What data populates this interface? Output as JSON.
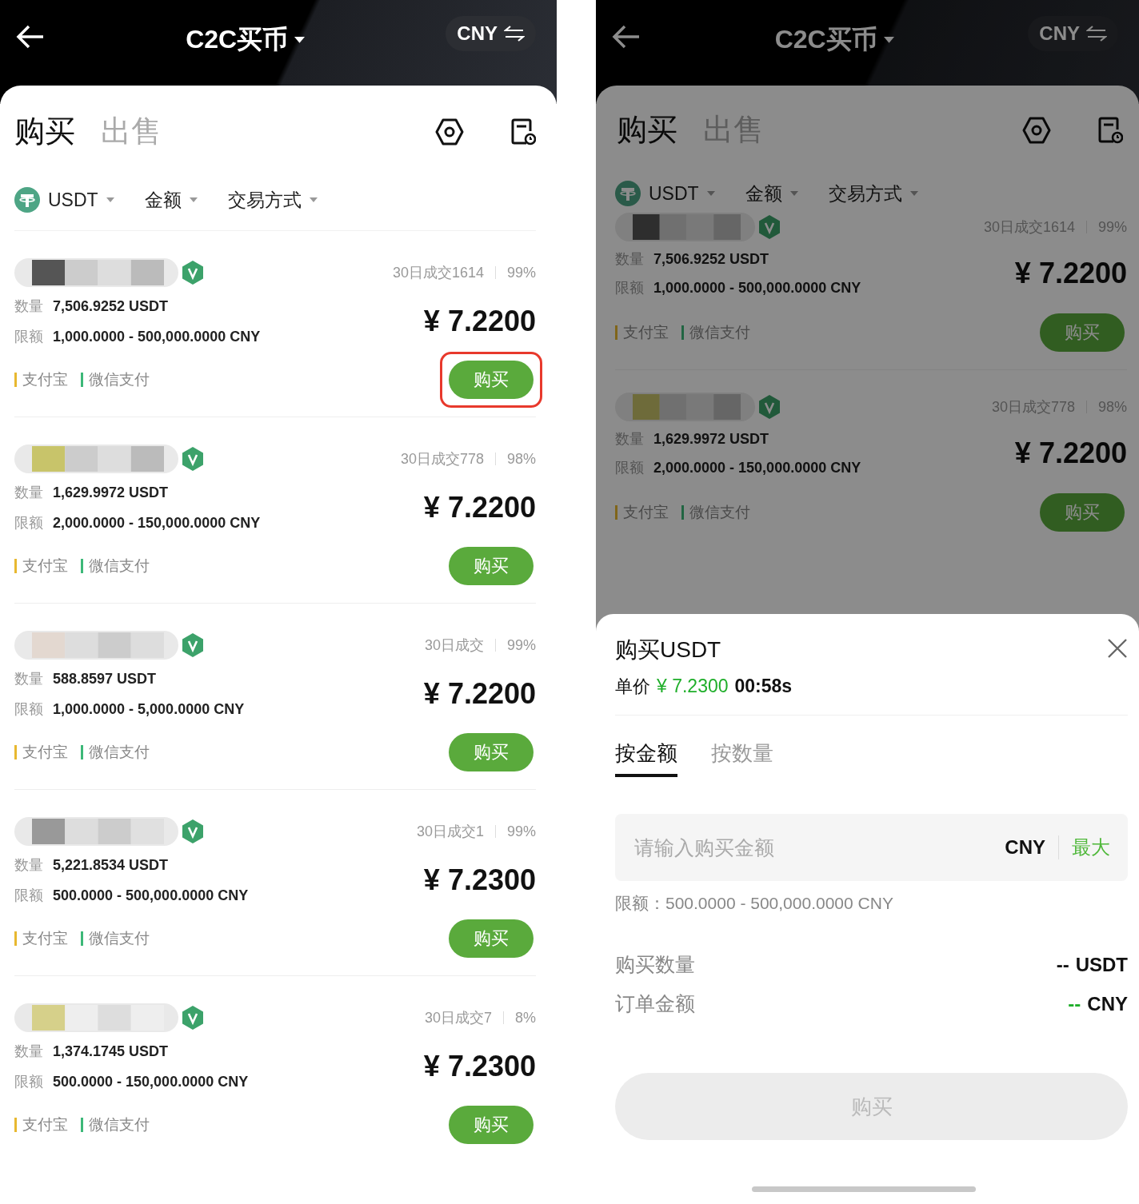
{
  "phones": [
    {
      "header": {
        "title": "C2C买币",
        "currency": "CNY"
      },
      "tabs": [
        {
          "label": "购买",
          "selected": true
        },
        {
          "label": "出售",
          "selected": false
        }
      ],
      "filters": [
        {
          "label": "USDT",
          "kind": "coin"
        },
        {
          "label": "金额",
          "kind": "plain"
        },
        {
          "label": "交易方式",
          "kind": "plain"
        }
      ],
      "offers": [
        {
          "volume": "30日成交1614",
          "rate": "99%",
          "quantity_label": "数量",
          "quantity": "7,506.9252 USDT",
          "limit_label": "限额",
          "limit": "1,000.0000 - 500,000.0000 CNY",
          "price": "¥ 7.2200",
          "payments": [
            {
              "label": "支付宝",
              "color": "#e8b830"
            },
            {
              "label": "微信支付",
              "color": "#3cb878"
            }
          ],
          "button": "购买",
          "highlighted": true
        },
        {
          "volume": "30日成交778",
          "rate": "98%",
          "quantity_label": "数量",
          "quantity": "1,629.9972 USDT",
          "limit_label": "限额",
          "limit": "2,000.0000 - 150,000.0000 CNY",
          "price": "¥ 7.2200",
          "payments": [
            {
              "label": "支付宝",
              "color": "#e8b830"
            },
            {
              "label": "微信支付",
              "color": "#3cb878"
            }
          ],
          "button": "购买",
          "highlighted": false
        },
        {
          "volume": "30日成交",
          "rate": "99%",
          "quantity_label": "数量",
          "quantity": "588.8597 USDT",
          "limit_label": "限额",
          "limit": "1,000.0000 - 5,000.0000 CNY",
          "price": "¥ 7.2200",
          "payments": [
            {
              "label": "支付宝",
              "color": "#e8b830"
            },
            {
              "label": "微信支付",
              "color": "#3cb878"
            }
          ],
          "button": "购买",
          "highlighted": false
        },
        {
          "volume": "30日成交1",
          "rate": "99%",
          "quantity_label": "数量",
          "quantity": "5,221.8534 USDT",
          "limit_label": "限额",
          "limit": "500.0000 - 500,000.0000 CNY",
          "price": "¥ 7.2300",
          "payments": [
            {
              "label": "支付宝",
              "color": "#e8b830"
            },
            {
              "label": "微信支付",
              "color": "#3cb878"
            }
          ],
          "button": "购买",
          "highlighted": false
        },
        {
          "volume": "30日成交7",
          "rate": "8%",
          "quantity_label": "数量",
          "quantity": "1,374.1745 USDT",
          "limit_label": "限额",
          "limit": "500.0000 - 150,000.0000 CNY",
          "price": "¥ 7.2300",
          "payments": [
            {
              "label": "支付宝",
              "color": "#e8b830"
            },
            {
              "label": "微信支付",
              "color": "#3cb878"
            }
          ],
          "button": "购买",
          "highlighted": false
        }
      ]
    },
    {
      "header": {
        "title": "C2C买币",
        "currency": "CNY"
      },
      "tabs": [
        {
          "label": "购买",
          "selected": true
        },
        {
          "label": "出售",
          "selected": false
        }
      ],
      "filters": [
        {
          "label": "USDT",
          "kind": "coin"
        },
        {
          "label": "金额",
          "kind": "plain"
        },
        {
          "label": "交易方式",
          "kind": "plain"
        }
      ],
      "offers": [
        {
          "volume": "30日成交1614",
          "rate": "99%",
          "quantity_label": "数量",
          "quantity": "7,506.9252 USDT",
          "limit_label": "限额",
          "limit": "1,000.0000 - 500,000.0000 CNY",
          "price": "¥ 7.2200",
          "payments": [
            {
              "label": "支付宝",
              "color": "#80651a"
            },
            {
              "label": "微信支付",
              "color": "#216542"
            }
          ],
          "button": "购买",
          "highlighted": false
        },
        {
          "volume": "30日成交778",
          "rate": "98%",
          "quantity_label": "数量",
          "quantity": "1,629.9972 USDT",
          "limit_label": "限额",
          "limit": "2,000.0000 - 150,000.0000 CNY",
          "price": "¥ 7.2200",
          "payments": [
            {
              "label": "支付宝",
              "color": "#80651a"
            },
            {
              "label": "微信支付",
              "color": "#216542"
            }
          ],
          "button": "购买",
          "highlighted": false
        }
      ],
      "sheet": {
        "title": "购买USDT",
        "price_label": "单价",
        "price": "¥ 7.2300",
        "countdown": "00:58s",
        "tabs": [
          {
            "label": "按金额",
            "selected": true
          },
          {
            "label": "按数量",
            "selected": false
          }
        ],
        "input": {
          "placeholder": "请输入购买金额",
          "unit": "CNY",
          "max": "最大"
        },
        "limit": "限额：500.0000 - 500,000.0000 CNY",
        "summary": [
          {
            "label": "购买数量",
            "dash": "--",
            "unit": "USDT",
            "accent": false
          },
          {
            "label": "订单金额",
            "dash": "--",
            "unit": "CNY",
            "accent": true
          }
        ],
        "button": {
          "label": "购买",
          "disabled": true
        }
      }
    }
  ]
}
